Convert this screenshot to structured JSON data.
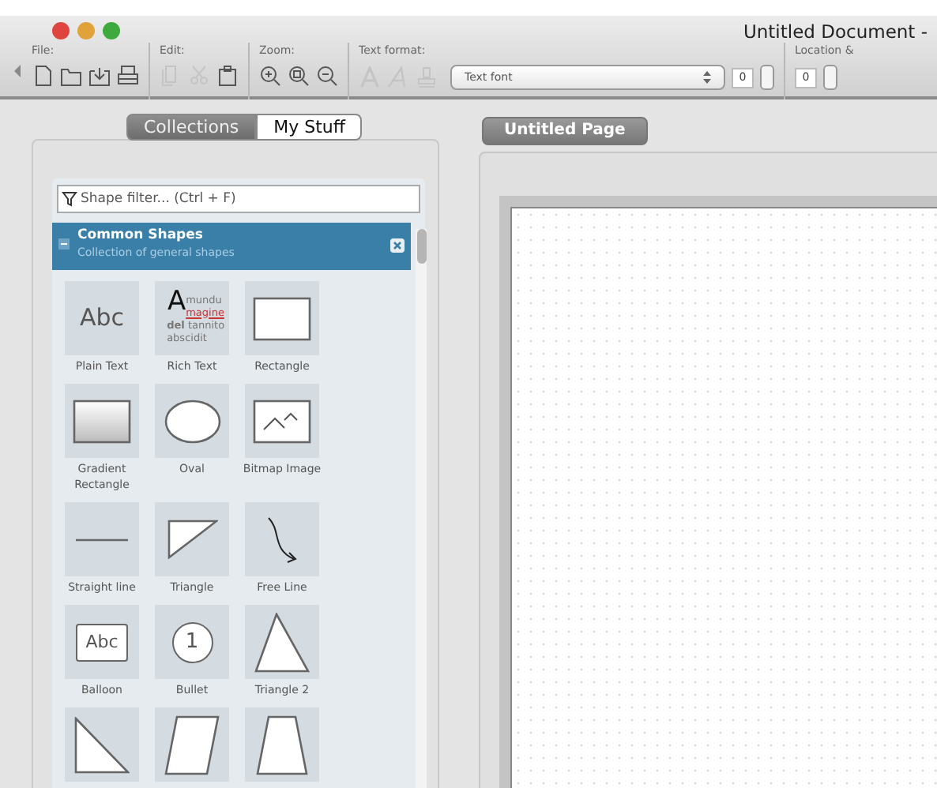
{
  "window": {
    "title": "Untitled Document -"
  },
  "toolbar": [
    {
      "label": "File:",
      "tools": [
        {
          "kind": "document",
          "disabled": false
        },
        {
          "kind": "folder",
          "disabled": false
        },
        {
          "kind": "tray",
          "disabled": false
        },
        {
          "kind": "printer",
          "disabled": false
        }
      ]
    },
    {
      "label": "Edit:",
      "tools": [
        {
          "kind": "copy",
          "disabled": true
        },
        {
          "kind": "scissors",
          "disabled": true
        },
        {
          "kind": "clipboard",
          "disabled": false
        }
      ]
    },
    {
      "label": "Zoom:",
      "tools": [
        {
          "kind": "zoomin",
          "disabled": false
        },
        {
          "kind": "zoomfit",
          "disabled": false
        },
        {
          "kind": "zoomout",
          "disabled": false
        }
      ]
    },
    {
      "label": "Text format:",
      "tools": [
        {
          "kind": "letter",
          "disabled": true
        },
        {
          "kind": "italic",
          "disabled": true
        },
        {
          "kind": "stamp",
          "disabled": true
        }
      ],
      "font": {
        "value": "Text font"
      },
      "size": {
        "value": "0"
      }
    },
    {
      "label": "Location &",
      "size": {
        "value": "0"
      }
    }
  ],
  "tabs": [
    {
      "label": "Collections",
      "selected": true
    },
    {
      "label": "My Stuff",
      "selected": false
    }
  ],
  "filter": {
    "placeholder": "Shape filter... (Ctrl + F)"
  },
  "collection": {
    "title": "Common Shapes",
    "subtitle": "Collection of general shapes",
    "expanded": true
  },
  "shapes": [
    {
      "kind": "text",
      "label": "Plain Text",
      "preview": "Abc"
    },
    {
      "kind": "richtext",
      "label": "Rich Text",
      "preview_letter": "A",
      "preview_lines": [
        "mundu",
        "magine",
        "**del** tannito",
        "abscidit"
      ]
    },
    {
      "kind": "rectangle",
      "label": "Rectangle"
    },
    {
      "kind": "gradient",
      "label": "Gradient Rectangle"
    },
    {
      "kind": "oval",
      "label": "Oval"
    },
    {
      "kind": "image",
      "label": "Bitmap Image"
    },
    {
      "kind": "line",
      "label": "Straight line"
    },
    {
      "kind": "triangle",
      "label": "Triangle"
    },
    {
      "kind": "curve",
      "label": "Free Line"
    },
    {
      "kind": "balloon",
      "label": "Balloon",
      "preview": "Abc"
    },
    {
      "kind": "bullet",
      "label": "Bullet",
      "preview": "1"
    },
    {
      "kind": "triangle2",
      "label": "Triangle 2"
    },
    {
      "kind": "righttriangle"
    },
    {
      "kind": "parallelogram"
    },
    {
      "kind": "trapezoid"
    }
  ],
  "page_tab": {
    "label": "Untitled Page",
    "selected": true
  }
}
